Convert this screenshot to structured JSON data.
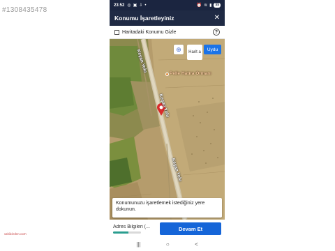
{
  "listing_id": "#1308435478",
  "watermark": "sahibinden.com",
  "status_bar": {
    "time": "23:52",
    "left_icons": [
      "whatsapp-icon",
      "message-icon",
      "download-icon",
      "dot-icon"
    ],
    "right_icons": [
      "alarm-icon",
      "wifi-icon",
      "signal-icon"
    ],
    "battery": "55"
  },
  "header": {
    "title": "Konumu İşaretleyiniz",
    "close_icon": "close-icon"
  },
  "hide_option": {
    "label": "Haritadaki Konumu Gizle",
    "checked": false,
    "help_icon": "?"
  },
  "map": {
    "buttons": {
      "location_icon": "my-location-icon",
      "harita_label": "Harit a",
      "uydu_label": "Uydu"
    },
    "poi": {
      "name": "Pelle Hatıra Ormanı"
    },
    "road_labels": [
      "Keşan Yolu",
      "Keşan Yolu",
      "Keşan Yolu"
    ],
    "road_short_label": "Ke",
    "hint": "Konumunuzu işaretlemek istediğiniz yere dokunun."
  },
  "footer": {
    "step_label": "Adres Bilgileri (...",
    "progress": 0.55,
    "continue_label": "Devam Et"
  },
  "nav": {
    "recent_icon": "|||",
    "home_icon": "○",
    "back_icon": "<"
  },
  "colors": {
    "header_bg": "#1f2a44",
    "accent_blue": "#1565d8",
    "uydu_blue": "#1a73e8",
    "pin_red": "#d92b2b",
    "progress_green": "#2a9d8f"
  }
}
